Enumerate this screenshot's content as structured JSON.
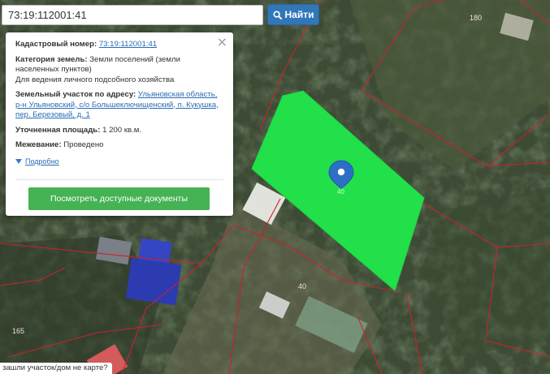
{
  "search": {
    "value": "73:19:112001:41",
    "button_label": "Найти",
    "button_icon": "search-icon"
  },
  "popup": {
    "cadastral_label": "Кадастровый номер:",
    "cadastral_value": "73:19:112001:41",
    "category_label": "Категория земель:",
    "category_value": "Земли поселений (земли населенных пунктов)",
    "usage_value": "Для ведения личного подсобного хозяйства",
    "address_label": "Земельный участок по адресу:",
    "address_value": "Ульяновская область, р-н Ульяновский, с/о Большеключищенский, п. Кукушка, пер. Березовый, д. 1",
    "area_label": "Уточненная площадь:",
    "area_value": "1 200 кв.м.",
    "survey_label": "Межевание:",
    "survey_value": "Проведено",
    "more_label": "Подробно",
    "docs_button": "Посмотреть доступные документы",
    "close_icon": "close-icon"
  },
  "map": {
    "parcel_color": "#22e049",
    "boundary_color": "#c8232c",
    "labels": {
      "parcel_180": "180",
      "parcel_40": "40",
      "parcel_165": "165",
      "marker_number": "40"
    }
  },
  "footer_hint": "зашли участок/дом не карте?"
}
